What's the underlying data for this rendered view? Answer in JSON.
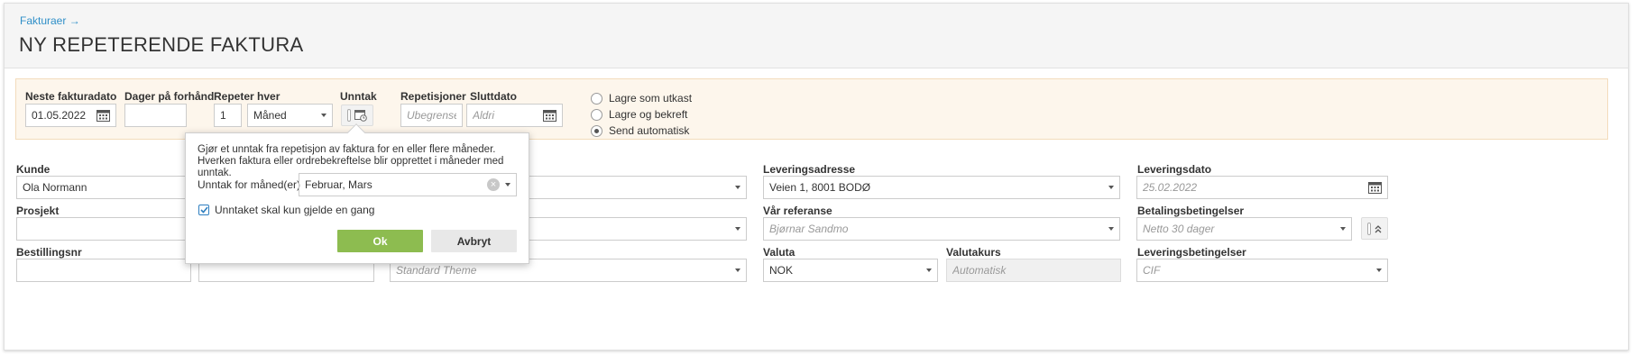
{
  "breadcrumb": {
    "label": "Fakturaer",
    "arrow": "→"
  },
  "page_title": "NY REPETERENDE FAKTURA",
  "schedule": {
    "next_invoice_date": {
      "label": "Neste fakturadato",
      "value": "01.05.2022"
    },
    "days_in_advance": {
      "label": "Dager på forhånd",
      "value": ""
    },
    "repeat_every": {
      "label": "Repeter hver",
      "count": "1",
      "unit": "Måned"
    },
    "exceptions": {
      "label": "Unntak"
    },
    "repetitions": {
      "label": "Repetisjoner",
      "placeholder": "Ubegrenset"
    },
    "end_date": {
      "label": "Sluttdato",
      "placeholder": "Aldri"
    },
    "save_options": [
      {
        "label": "Lagre som utkast",
        "checked": false
      },
      {
        "label": "Lagre og bekreft",
        "checked": false
      },
      {
        "label": "Send automatisk",
        "checked": true
      }
    ]
  },
  "exception_popover": {
    "description": "Gjør et unntak fra repetisjon av faktura for en eller flere måneder. Hverken faktura eller ordrebekreftelse blir opprettet i måneder med unntak.",
    "months_label": "Unntak for måned(er)",
    "months_value": "Februar, Mars",
    "once_label": "Unntaket skal kun gjelde en gang",
    "once_checked": true,
    "ok_label": "Ok",
    "cancel_label": "Avbryt"
  },
  "form": {
    "customer": {
      "label": "Kunde",
      "value": "Ola Normann"
    },
    "project": {
      "label": "Prosjekt",
      "value": ""
    },
    "order_number": {
      "label": "Bestillingsnr",
      "value": ""
    },
    "theme": {
      "placeholder": "Standard Theme"
    },
    "delivery_address": {
      "label": "Leveringsadresse",
      "value": "Veien 1, 8001 BODØ"
    },
    "our_reference": {
      "label": "Vår referanse",
      "placeholder": "Bjørnar Sandmo"
    },
    "currency": {
      "label": "Valuta",
      "value": "NOK"
    },
    "exchange_rate": {
      "label": "Valutakurs",
      "placeholder": "Automatisk"
    },
    "delivery_date": {
      "label": "Leveringsdato",
      "placeholder": "25.02.2022"
    },
    "payment_terms": {
      "label": "Betalingsbetingelser",
      "placeholder": "Netto 30 dager"
    },
    "delivery_terms": {
      "label": "Leveringsbetingelser",
      "placeholder": "CIF"
    }
  },
  "colors": {
    "link": "#2f8fc8",
    "ok_button": "#8dbc50",
    "panel_bg": "#fdf6ec",
    "panel_border": "#f3dcbc"
  }
}
